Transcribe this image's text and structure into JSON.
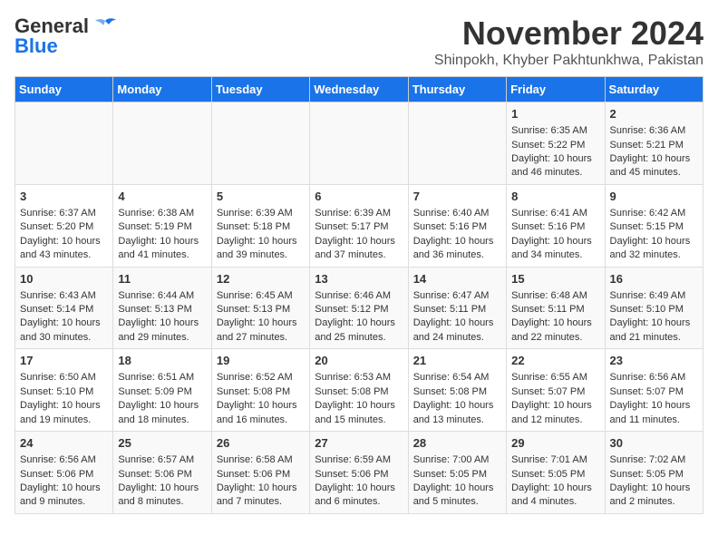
{
  "header": {
    "logo_general": "General",
    "logo_blue": "Blue",
    "month": "November 2024",
    "location": "Shinpokh, Khyber Pakhtunkhwa, Pakistan"
  },
  "weekdays": [
    "Sunday",
    "Monday",
    "Tuesday",
    "Wednesday",
    "Thursday",
    "Friday",
    "Saturday"
  ],
  "weeks": [
    [
      {
        "day": "",
        "info": ""
      },
      {
        "day": "",
        "info": ""
      },
      {
        "day": "",
        "info": ""
      },
      {
        "day": "",
        "info": ""
      },
      {
        "day": "",
        "info": ""
      },
      {
        "day": "1",
        "info": "Sunrise: 6:35 AM\nSunset: 5:22 PM\nDaylight: 10 hours and 46 minutes."
      },
      {
        "day": "2",
        "info": "Sunrise: 6:36 AM\nSunset: 5:21 PM\nDaylight: 10 hours and 45 minutes."
      }
    ],
    [
      {
        "day": "3",
        "info": "Sunrise: 6:37 AM\nSunset: 5:20 PM\nDaylight: 10 hours and 43 minutes."
      },
      {
        "day": "4",
        "info": "Sunrise: 6:38 AM\nSunset: 5:19 PM\nDaylight: 10 hours and 41 minutes."
      },
      {
        "day": "5",
        "info": "Sunrise: 6:39 AM\nSunset: 5:18 PM\nDaylight: 10 hours and 39 minutes."
      },
      {
        "day": "6",
        "info": "Sunrise: 6:39 AM\nSunset: 5:17 PM\nDaylight: 10 hours and 37 minutes."
      },
      {
        "day": "7",
        "info": "Sunrise: 6:40 AM\nSunset: 5:16 PM\nDaylight: 10 hours and 36 minutes."
      },
      {
        "day": "8",
        "info": "Sunrise: 6:41 AM\nSunset: 5:16 PM\nDaylight: 10 hours and 34 minutes."
      },
      {
        "day": "9",
        "info": "Sunrise: 6:42 AM\nSunset: 5:15 PM\nDaylight: 10 hours and 32 minutes."
      }
    ],
    [
      {
        "day": "10",
        "info": "Sunrise: 6:43 AM\nSunset: 5:14 PM\nDaylight: 10 hours and 30 minutes."
      },
      {
        "day": "11",
        "info": "Sunrise: 6:44 AM\nSunset: 5:13 PM\nDaylight: 10 hours and 29 minutes."
      },
      {
        "day": "12",
        "info": "Sunrise: 6:45 AM\nSunset: 5:13 PM\nDaylight: 10 hours and 27 minutes."
      },
      {
        "day": "13",
        "info": "Sunrise: 6:46 AM\nSunset: 5:12 PM\nDaylight: 10 hours and 25 minutes."
      },
      {
        "day": "14",
        "info": "Sunrise: 6:47 AM\nSunset: 5:11 PM\nDaylight: 10 hours and 24 minutes."
      },
      {
        "day": "15",
        "info": "Sunrise: 6:48 AM\nSunset: 5:11 PM\nDaylight: 10 hours and 22 minutes."
      },
      {
        "day": "16",
        "info": "Sunrise: 6:49 AM\nSunset: 5:10 PM\nDaylight: 10 hours and 21 minutes."
      }
    ],
    [
      {
        "day": "17",
        "info": "Sunrise: 6:50 AM\nSunset: 5:10 PM\nDaylight: 10 hours and 19 minutes."
      },
      {
        "day": "18",
        "info": "Sunrise: 6:51 AM\nSunset: 5:09 PM\nDaylight: 10 hours and 18 minutes."
      },
      {
        "day": "19",
        "info": "Sunrise: 6:52 AM\nSunset: 5:08 PM\nDaylight: 10 hours and 16 minutes."
      },
      {
        "day": "20",
        "info": "Sunrise: 6:53 AM\nSunset: 5:08 PM\nDaylight: 10 hours and 15 minutes."
      },
      {
        "day": "21",
        "info": "Sunrise: 6:54 AM\nSunset: 5:08 PM\nDaylight: 10 hours and 13 minutes."
      },
      {
        "day": "22",
        "info": "Sunrise: 6:55 AM\nSunset: 5:07 PM\nDaylight: 10 hours and 12 minutes."
      },
      {
        "day": "23",
        "info": "Sunrise: 6:56 AM\nSunset: 5:07 PM\nDaylight: 10 hours and 11 minutes."
      }
    ],
    [
      {
        "day": "24",
        "info": "Sunrise: 6:56 AM\nSunset: 5:06 PM\nDaylight: 10 hours and 9 minutes."
      },
      {
        "day": "25",
        "info": "Sunrise: 6:57 AM\nSunset: 5:06 PM\nDaylight: 10 hours and 8 minutes."
      },
      {
        "day": "26",
        "info": "Sunrise: 6:58 AM\nSunset: 5:06 PM\nDaylight: 10 hours and 7 minutes."
      },
      {
        "day": "27",
        "info": "Sunrise: 6:59 AM\nSunset: 5:06 PM\nDaylight: 10 hours and 6 minutes."
      },
      {
        "day": "28",
        "info": "Sunrise: 7:00 AM\nSunset: 5:05 PM\nDaylight: 10 hours and 5 minutes."
      },
      {
        "day": "29",
        "info": "Sunrise: 7:01 AM\nSunset: 5:05 PM\nDaylight: 10 hours and 4 minutes."
      },
      {
        "day": "30",
        "info": "Sunrise: 7:02 AM\nSunset: 5:05 PM\nDaylight: 10 hours and 2 minutes."
      }
    ]
  ]
}
